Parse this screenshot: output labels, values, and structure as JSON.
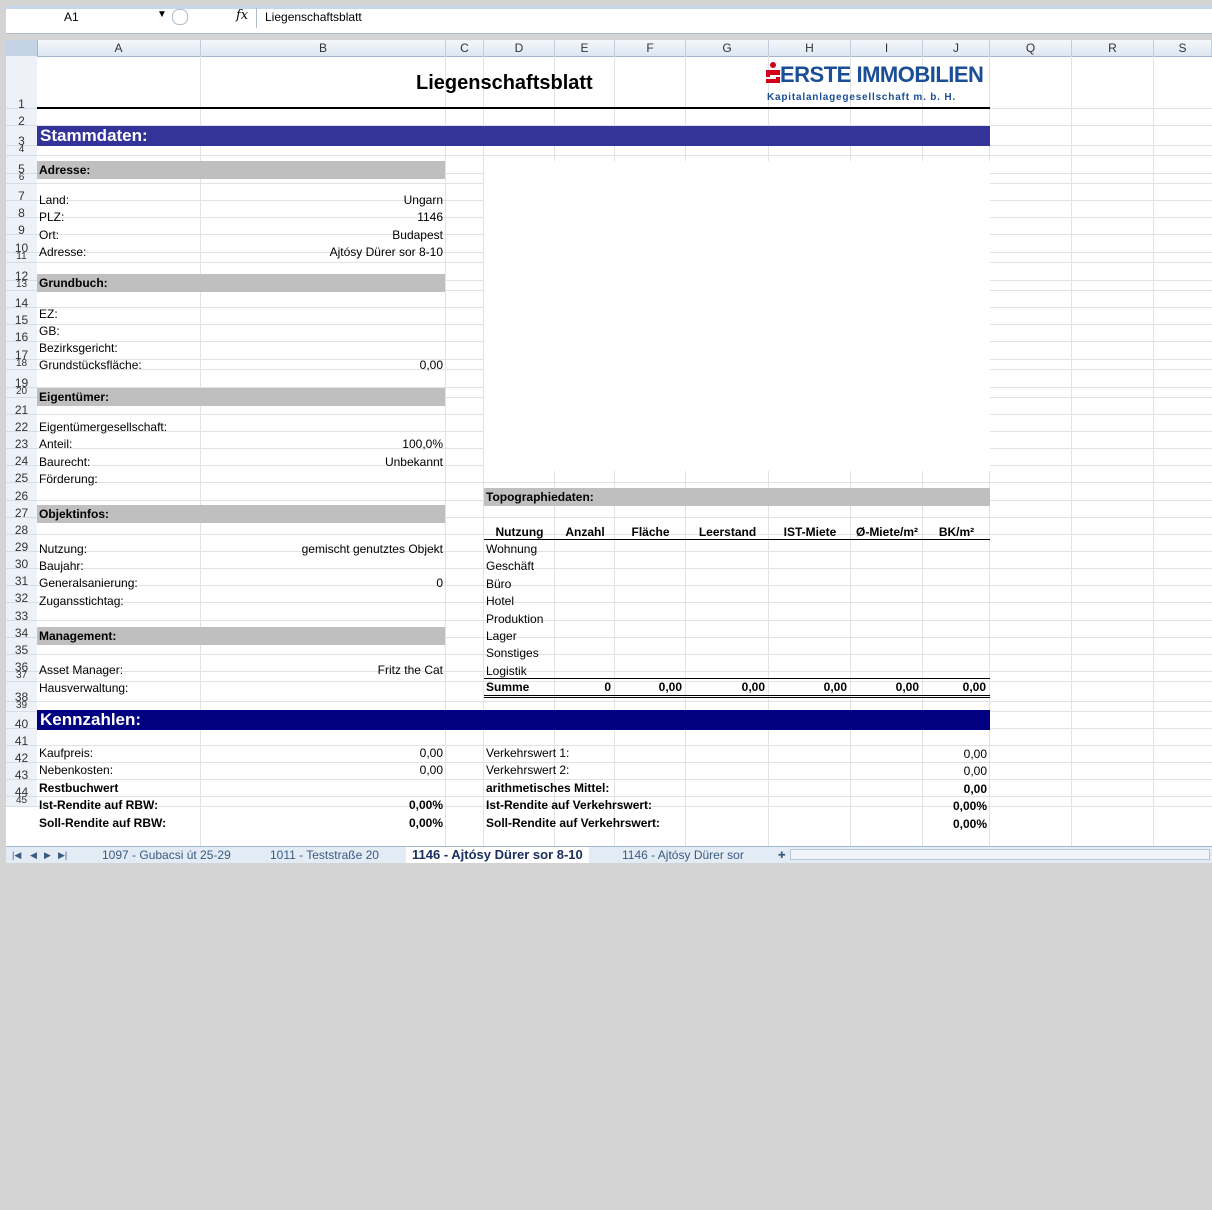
{
  "formula_bar": {
    "name_box": "A1",
    "fx": "fx",
    "value": "Liegenschaftsblatt"
  },
  "columns": [
    "A",
    "B",
    "C",
    "D",
    "E",
    "F",
    "G",
    "H",
    "I",
    "J",
    "Q",
    "R",
    "S"
  ],
  "rows": [
    "1",
    "2",
    "3",
    "4",
    "5",
    "6",
    "7",
    "8",
    "9",
    "10",
    "11",
    "12",
    "13",
    "14",
    "15",
    "16",
    "17",
    "18",
    "19",
    "20",
    "21",
    "22",
    "23",
    "24",
    "25",
    "26",
    "27",
    "28",
    "29",
    "30",
    "31",
    "32",
    "33",
    "34",
    "35",
    "36",
    "37",
    "38",
    "39",
    "40",
    "41",
    "42",
    "43",
    "44",
    "45"
  ],
  "title": "Liegenschaftsblatt",
  "logo": {
    "main": "ERSTE IMMOBILIEN",
    "sub": "Kapitalanlagegesellschaft m. b. H."
  },
  "stammdaten": {
    "header": "Stammdaten:",
    "adresse": {
      "label": "Adresse:",
      "land_l": "Land:",
      "land_v": "Ungarn",
      "plz_l": "PLZ:",
      "plz_v": "1146",
      "ort_l": "Ort:",
      "ort_v": "Budapest",
      "adr_l": "Adresse:",
      "adr_v": "Ajtósy Dürer sor 8-10"
    },
    "grundbuch": {
      "label": "Grundbuch:",
      "ez": "EZ:",
      "gb": "GB:",
      "bez": "Bezirksgericht:",
      "gf_l": "Grundstücksfläche:",
      "gf_v": "0,00"
    },
    "eigentuemer": {
      "label": "Eigentümer:",
      "eg": "Eigentümergesellschaft:",
      "anteil_l": "Anteil:",
      "anteil_v": "100,0%",
      "baurecht_l": "Baurecht:",
      "baurecht_v": "Unbekannt",
      "foerd": "Förderung:"
    },
    "objekt": {
      "label": "Objektinfos:",
      "nutz_l": "Nutzung:",
      "nutz_v": "gemischt genutztes Objekt",
      "baujahr": "Baujahr:",
      "gen_l": "Generalsanierung:",
      "gen_v": "0",
      "zug": "Zugansstichtag:"
    },
    "management": {
      "label": "Management:",
      "am_l": "Asset Manager:",
      "am_v": "Fritz the Cat",
      "hv": "Hausverwaltung:"
    }
  },
  "topo": {
    "label": "Topographiedaten:",
    "headers": [
      "Nutzung",
      "Anzahl",
      "Fläche",
      "Leerstand",
      "IST-Miete",
      "Ø-Miete/m²",
      "BK/m²"
    ],
    "rows": [
      "Wohnung",
      "Geschäft",
      "Büro",
      "Hotel",
      "Produktion",
      "Lager",
      "Sonstiges",
      "Logistik"
    ],
    "sum": [
      "Summe",
      "0",
      "0,00",
      "0,00",
      "0,00",
      "0,00",
      "0,00"
    ]
  },
  "kennzahlen": {
    "header": "Kennzahlen:",
    "kauf_l": "Kaufpreis:",
    "kauf_v": "0,00",
    "neben_l": "Nebenkosten:",
    "neben_v": "0,00",
    "rest_l": "Restbuchwert",
    "ist_l": "Ist-Rendite auf RBW:",
    "ist_v": "0,00%",
    "soll_l": "Soll-Rendite auf RBW:",
    "soll_v": "0,00%",
    "vw1_l": "Verkehrswert 1:",
    "vw1_v": "0,00",
    "vw2_l": "Verkehrswert 2:",
    "vw2_v": "0,00",
    "am_l": "arithmetisches Mittel:",
    "am_v": "0,00",
    "istvw_l": "Ist-Rendite auf Verkehrswert:",
    "istvw_v": "0,00%",
    "sollvw_l": "Soll-Rendite auf Verkehrswert:",
    "sollvw_v": "0,00%"
  },
  "tabs": [
    "1097 - Gubacsi út 25-29",
    "1011 - Teststraße 20",
    "1146 - Ajtósy Dürer sor 8-10",
    "1146 - Ajtósy Dürer sor"
  ]
}
